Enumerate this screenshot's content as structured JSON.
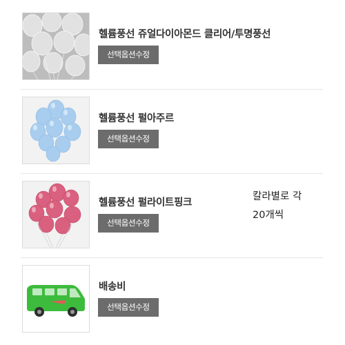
{
  "products": [
    {
      "name": "헬륨풍선 쥬얼다이아몬드 클리어/투명풍선",
      "option_button": "선택옵션수정",
      "image": "clear-balloons-photo"
    },
    {
      "name": "헬륨풍선 펄아주르",
      "option_button": "선택옵션수정",
      "image": "blue-balloons-photo"
    },
    {
      "name": "헬륨풍선 펄라이트핑크",
      "option_button": "선택옵션수정",
      "image": "pink-balloons-photo"
    },
    {
      "name": "배송비",
      "option_button": "선택옵션수정",
      "image": "delivery-van-icon"
    }
  ],
  "note": {
    "line1": "칼라별로 각",
    "line2": "20개씩"
  },
  "colors": {
    "button_bg": "#6c6c6c",
    "balloon_clear": "#e8e8e8",
    "balloon_blue": "#a8cdee",
    "balloon_pink": "#d9607e",
    "van_green": "#3dbb3d"
  }
}
